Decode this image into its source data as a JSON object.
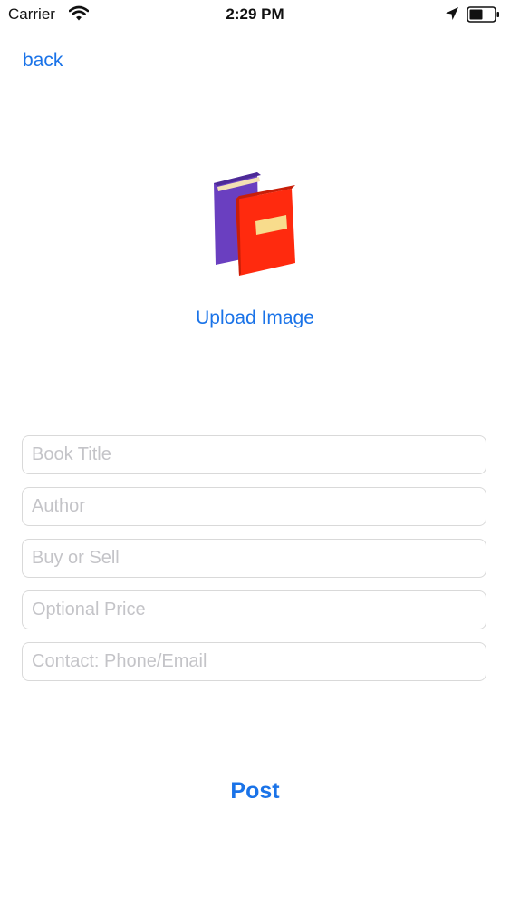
{
  "status_bar": {
    "carrier": "Carrier",
    "time": "2:29 PM",
    "icons": [
      "wifi-icon",
      "location-arrow-icon",
      "battery-icon"
    ]
  },
  "nav": {
    "back_label": "back"
  },
  "upload": {
    "icon": "books-icon",
    "label": "Upload Image"
  },
  "form": {
    "book_title_placeholder": "Book Title",
    "author_placeholder": "Author",
    "buy_sell_placeholder": "Buy or Sell",
    "price_placeholder": "Optional Price",
    "contact_placeholder": "Contact: Phone/Email"
  },
  "actions": {
    "post_label": "Post"
  },
  "colors": {
    "accent": "#1a73e8",
    "book_back": "#6a3fc0",
    "book_front": "#ff2a0e",
    "book_label": "#f8dc8c"
  }
}
